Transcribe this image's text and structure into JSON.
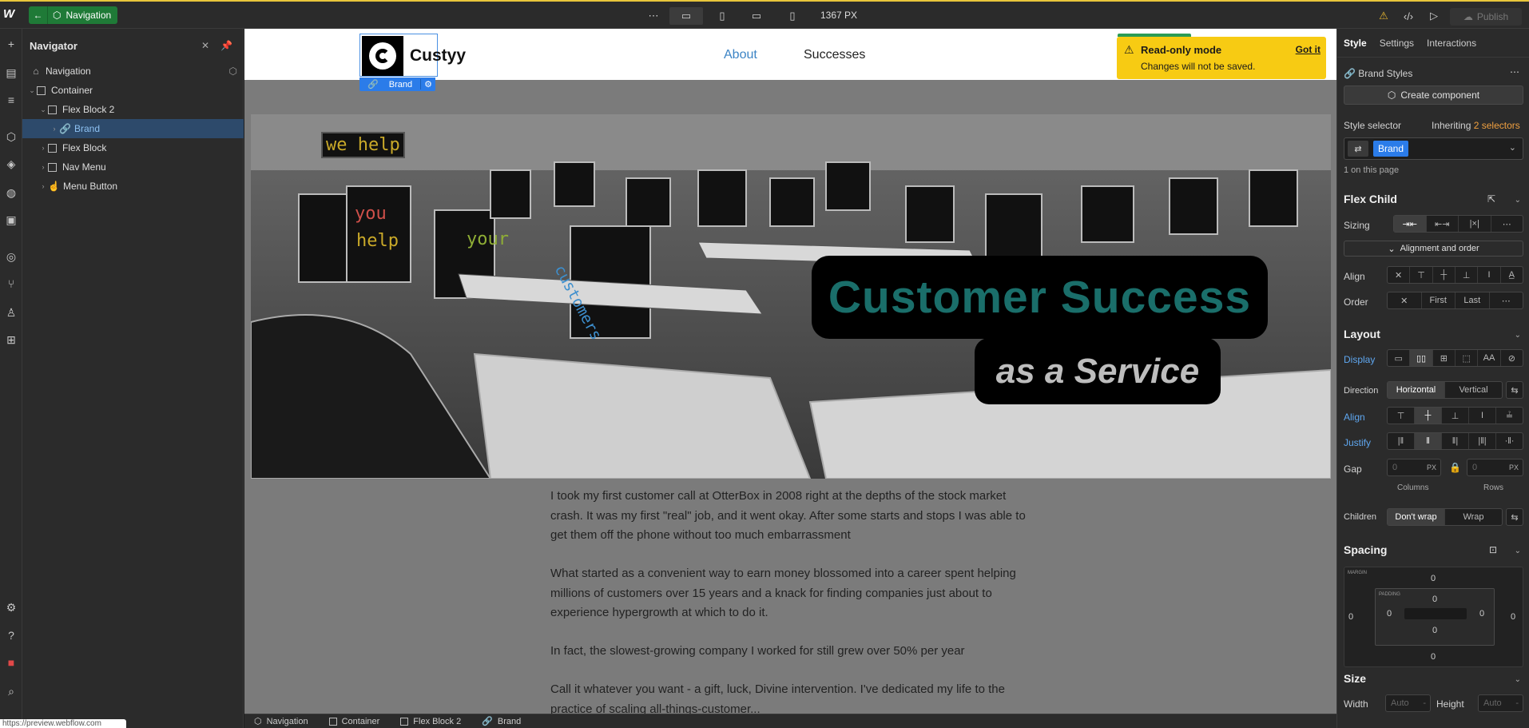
{
  "topbar": {
    "component_label": "Navigation",
    "breakpoint_width": "1367 PX",
    "publish_label": "Publish"
  },
  "navigator": {
    "title": "Navigator",
    "tree": [
      {
        "label": "Navigation",
        "depth": 0
      },
      {
        "label": "Container",
        "depth": 1
      },
      {
        "label": "Flex Block 2",
        "depth": 2
      },
      {
        "label": "Brand",
        "depth": 3,
        "selected": true
      },
      {
        "label": "Flex Block",
        "depth": 2
      },
      {
        "label": "Nav Menu",
        "depth": 2
      },
      {
        "label": "Menu Button",
        "depth": 2
      }
    ]
  },
  "site": {
    "brand_name": "Custyy",
    "brand_tag": "Brand",
    "nav_links": [
      "About",
      "Successes"
    ],
    "hero_title": "Customer Success",
    "hero_subtitle": "as a Service",
    "neon_words": [
      "we help",
      "you",
      "help",
      "your",
      "customers"
    ],
    "paragraphs": [
      "I took my first customer call at OtterBox in 2008 right at the depths of the stock market crash. It was my first \"real\" job, and it went okay. After some starts and stops I was able to get them off the phone without too much embarrassment",
      "What started as a convenient way to earn money blossomed into a career spent helping millions of customers over 15 years and a knack for finding companies just about to experience hypergrowth at which to do it.",
      "In fact, the slowest-growing company I worked for still grew over 50% per year",
      "Call it whatever you want - a gift, luck, Divine intervention. I've dedicated my life to the practice of scaling all-things-customer..."
    ]
  },
  "toast": {
    "title": "Read-only mode",
    "subtitle": "Changes will not be saved.",
    "action": "Got it"
  },
  "breadcrumbs": [
    "Navigation",
    "Container",
    "Flex Block 2",
    "Brand"
  ],
  "status_url": "https://preview.webflow.com",
  "style_panel": {
    "tabs": [
      "Style",
      "Settings",
      "Interactions"
    ],
    "brand_styles": "Brand Styles",
    "create_component": "Create component",
    "style_selector_label": "Style selector",
    "inheriting_prefix": "Inheriting",
    "inheriting_count": "2 selectors",
    "selector_class": "Brand",
    "on_this_page": "1 on this page",
    "flex_child": {
      "title": "Flex Child",
      "sizing_label": "Sizing",
      "alignment_order": "Alignment and order",
      "align_label": "Align",
      "order_label": "Order",
      "order_options": [
        "First",
        "Last"
      ]
    },
    "layout": {
      "title": "Layout",
      "display_label": "Display",
      "direction_label": "Direction",
      "direction_options": [
        "Horizontal",
        "Vertical"
      ],
      "align_label": "Align",
      "justify_label": "Justify",
      "gap_label": "Gap",
      "gap_unit": "PX",
      "gap_value": "0",
      "columns_label": "Columns",
      "rows_label": "Rows",
      "children_label": "Children",
      "children_options": [
        "Don't wrap",
        "Wrap"
      ]
    },
    "spacing": {
      "title": "Spacing",
      "margin_label": "MARGIN",
      "padding_label": "PADDING",
      "margin_top": "0",
      "margin_right": "0",
      "margin_bottom": "0",
      "margin_left": "0",
      "padding_top": "0",
      "padding_right": "0",
      "padding_bottom": "0",
      "padding_left": "0"
    },
    "size": {
      "title": "Size",
      "width_label": "Width",
      "height_label": "Height",
      "auto": "Auto"
    }
  },
  "colors": {
    "accent_blue": "#2b7ce9",
    "toast_yellow": "#f7cb13",
    "component_green": "#1f7a37",
    "hero_title_teal": "#1a6e6a"
  }
}
